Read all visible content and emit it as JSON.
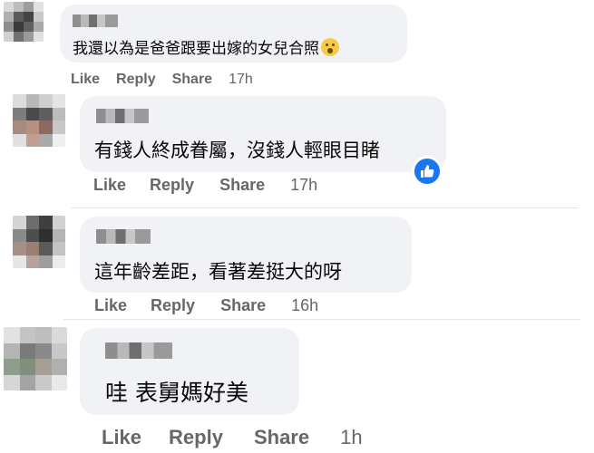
{
  "comments": [
    {
      "author": "",
      "text": "我還以為是爸爸跟要出嫁的女兒合照",
      "emoji": "astonished-face-emoji",
      "actions": {
        "like": "Like",
        "reply": "Reply",
        "share": "Share",
        "time": "17h"
      }
    },
    {
      "author": "",
      "text": "有錢人終成眷屬，沒錢人輕眼目睹",
      "reaction": "like",
      "actions": {
        "like": "Like",
        "reply": "Reply",
        "share": "Share",
        "time": "17h"
      }
    },
    {
      "author": "",
      "text": "這年齡差距，看著差挺大的呀",
      "actions": {
        "like": "Like",
        "reply": "Reply",
        "share": "Share",
        "time": "16h"
      }
    },
    {
      "author": "",
      "text": "哇 表舅媽好美",
      "actions": {
        "like": "Like",
        "reply": "Reply",
        "share": "Share",
        "time": "1h"
      }
    }
  ],
  "colors": {
    "bubble": "#f0f2f5",
    "action_text": "#65676b",
    "like_blue": "#1877f2"
  }
}
